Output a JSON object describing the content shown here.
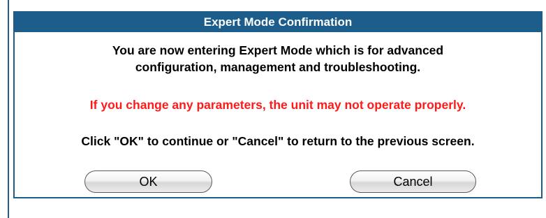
{
  "dialog": {
    "title": "Expert Mode Confirmation",
    "message_line1": "You are now entering Expert Mode which is for advanced",
    "message_line2": "configuration, management and troubleshooting.",
    "warning": "If you change any parameters, the unit may not operate properly.",
    "instruction": "Click \"OK\" to continue or \"Cancel\" to return to the previous screen.",
    "ok_label": "OK",
    "cancel_label": "Cancel"
  },
  "colors": {
    "title_bar": "#1d5d8c",
    "warning_text": "#ff1a1a"
  }
}
